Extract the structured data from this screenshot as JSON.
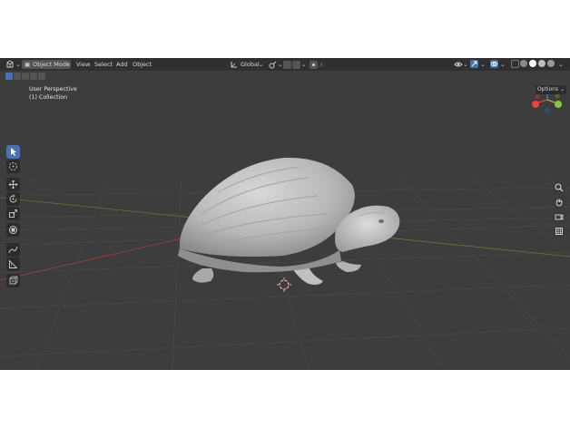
{
  "header": {
    "editor_type_icon": "3d-viewport-icon",
    "mode_label": "Object Mode",
    "menus": [
      "View",
      "Select",
      "Add",
      "Object"
    ],
    "orientation_label": "Global"
  },
  "viewport": {
    "perspective_label": "User Perspective",
    "collection_label": "(1) Collection",
    "options_label": "Options",
    "object": "turtle-sculpt-mesh"
  },
  "toolbar": {
    "tools": [
      "select-box-icon",
      "cursor-icon",
      "move-icon",
      "rotate-icon",
      "scale-icon",
      "transform-icon",
      "annotate-icon",
      "measure-icon",
      "add-cube-icon"
    ],
    "active_tool": "select-box-icon"
  },
  "navigation": {
    "gizmo_axes": [
      "X",
      "Y",
      "Z"
    ],
    "buttons": [
      "zoom-icon",
      "hand-pan-icon",
      "camera-icon",
      "grid-ortho-icon"
    ]
  },
  "colors": {
    "viewport_bg": "#3d3d3d",
    "header_bg": "#303030",
    "active_tool": "#4772b3",
    "x_axis": "#e0473f",
    "y_axis": "#8cc44a",
    "z_axis": "#3f87e0"
  }
}
